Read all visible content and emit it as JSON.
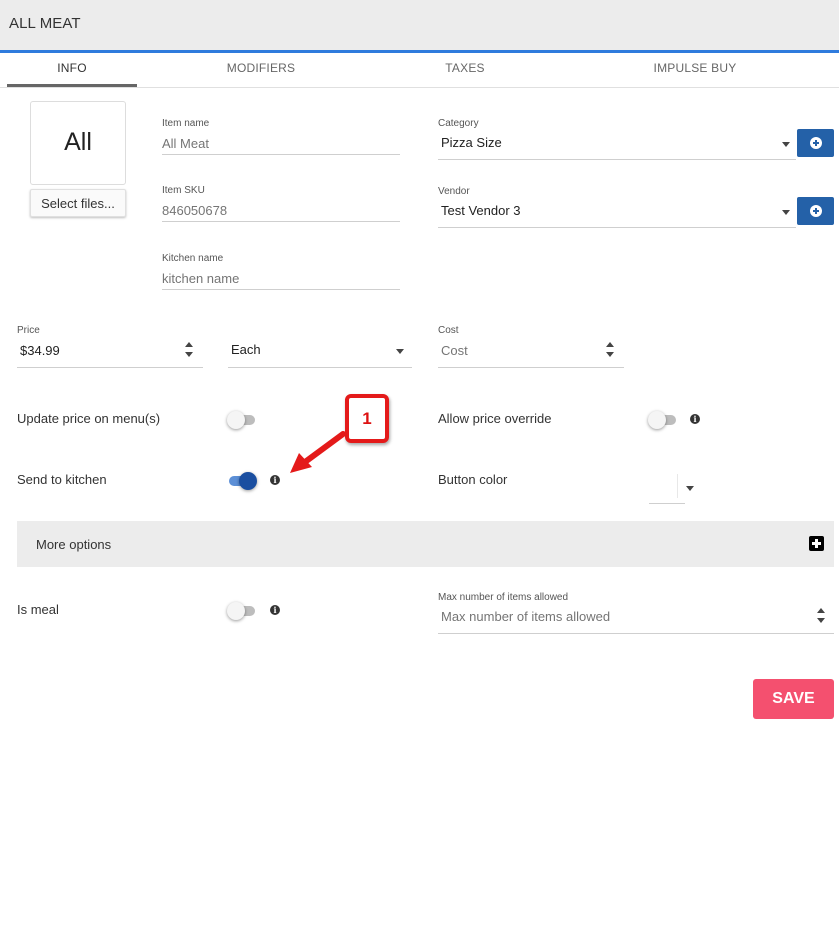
{
  "header": {
    "title": "ALL MEAT"
  },
  "tabs": [
    {
      "label": "INFO",
      "active": true
    },
    {
      "label": "MODIFIERS",
      "active": false
    },
    {
      "label": "TAXES",
      "active": false
    },
    {
      "label": "IMPULSE BUY",
      "active": false
    }
  ],
  "image": {
    "placeholder_text": "All",
    "select_files_label": "Select files..."
  },
  "item_name": {
    "label": "Item name",
    "value": "",
    "placeholder": "All Meat"
  },
  "item_sku": {
    "label": "Item SKU",
    "value": "",
    "placeholder": "846050678"
  },
  "kitchen_name": {
    "label": "Kitchen name",
    "value": "",
    "placeholder": "kitchen name"
  },
  "category": {
    "label": "Category",
    "value": "Pizza Size"
  },
  "vendor": {
    "label": "Vendor",
    "value": "Test Vendor 3"
  },
  "price": {
    "label": "Price",
    "value": "$34.99"
  },
  "unit": {
    "value": "Each"
  },
  "cost": {
    "label": "Cost",
    "value": "",
    "placeholder": "Cost"
  },
  "update_price": {
    "label": "Update price on menu(s)",
    "on": false
  },
  "allow_override": {
    "label": "Allow price override",
    "on": false
  },
  "send_to_kitchen": {
    "label": "Send to kitchen",
    "on": true
  },
  "button_color": {
    "label": "Button color",
    "value": "#ffffff"
  },
  "more_options": {
    "label": "More options"
  },
  "is_meal": {
    "label": "Is meal",
    "on": false
  },
  "max_items": {
    "label": "Max number of items allowed",
    "value": "",
    "placeholder": "Max number of items allowed"
  },
  "save": {
    "label": "SAVE"
  },
  "annotation": {
    "number": "1"
  },
  "colors": {
    "accent": "#2f7bdd",
    "add_button": "#2461a8",
    "save": "#f4506f",
    "toggle_on": "#1a4ea0",
    "annotation": "#e41a1a"
  }
}
